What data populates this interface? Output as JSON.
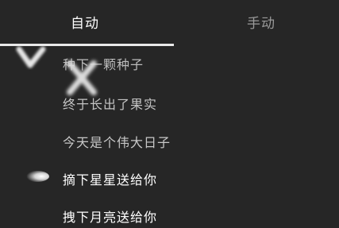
{
  "tabs": [
    {
      "label": "自动",
      "active": true
    },
    {
      "label": "手动",
      "active": false
    }
  ],
  "lyrics": [
    "种下一颗种子",
    "终于长出了果实",
    "今天是个伟大日子",
    "摘下星星送给你",
    "拽下月亮送给你"
  ],
  "colors": {
    "background": "#262626",
    "active_tab": "#ffffff",
    "inactive_tab": "#9a9a9a",
    "indicator": "#e9e9e9"
  }
}
